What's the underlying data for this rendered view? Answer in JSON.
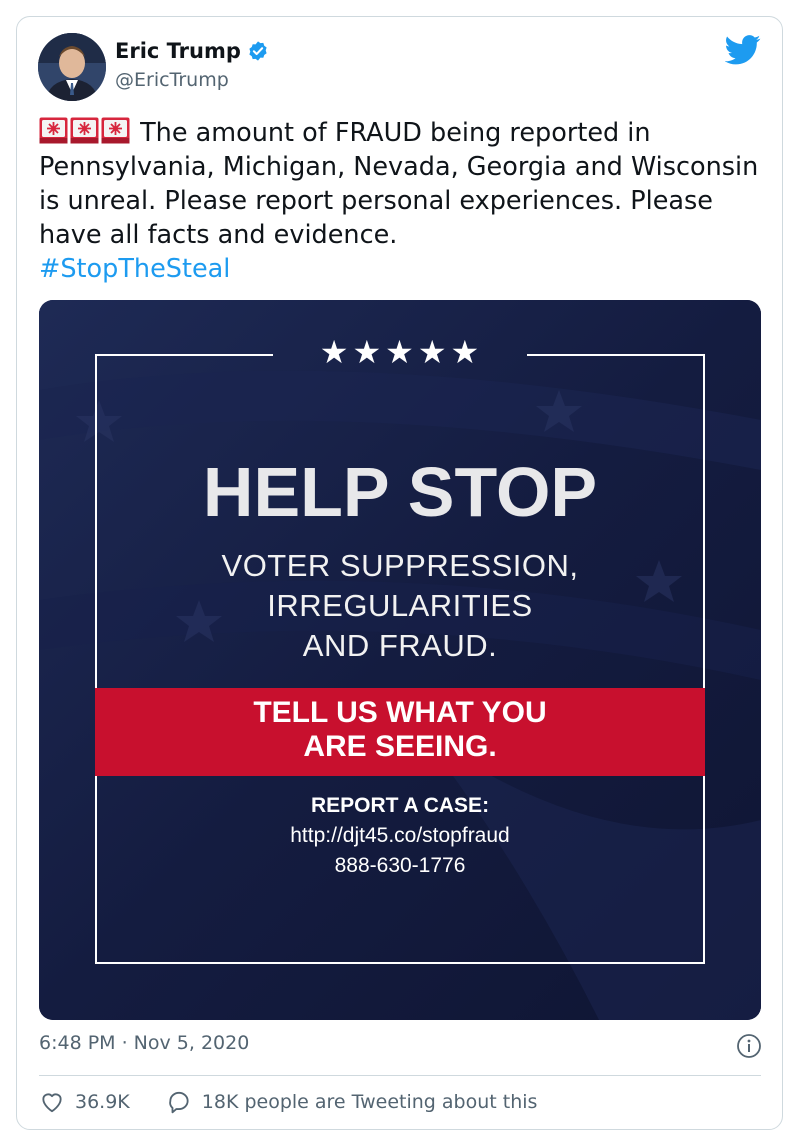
{
  "author": {
    "name": "Eric Trump",
    "handle": "@EricTrump",
    "verified": true
  },
  "tweet": {
    "emoji": [
      "police-light",
      "police-light",
      "police-light"
    ],
    "text": "The amount of FRAUD being reported in Pennsylvania, Michigan, Nevada, Georgia and Wisconsin is unreal. Please report personal experiences. Please have all facts and evidence.",
    "hashtag": "#StopTheSteal"
  },
  "media": {
    "stars": "★★★★★",
    "headline": "HELP STOP",
    "sub_lines": [
      "VOTER SUPPRESSION,",
      "IRREGULARITIES",
      "AND FRAUD."
    ],
    "callout_lines": [
      "TELL US WHAT YOU",
      "ARE SEEING."
    ],
    "report_label": "REPORT A CASE:",
    "report_url": "http://djt45.co/stopfraud",
    "report_phone": "888-630-1776"
  },
  "footer": {
    "timestamp": "6:48 PM · Nov 5, 2020",
    "likes": "36.9K",
    "tweeting": "18K people are Tweeting about this"
  },
  "colors": {
    "link": "#1d9bf0",
    "muted": "#536471",
    "media_bg": "#141c40",
    "band_red": "#c8102e"
  }
}
